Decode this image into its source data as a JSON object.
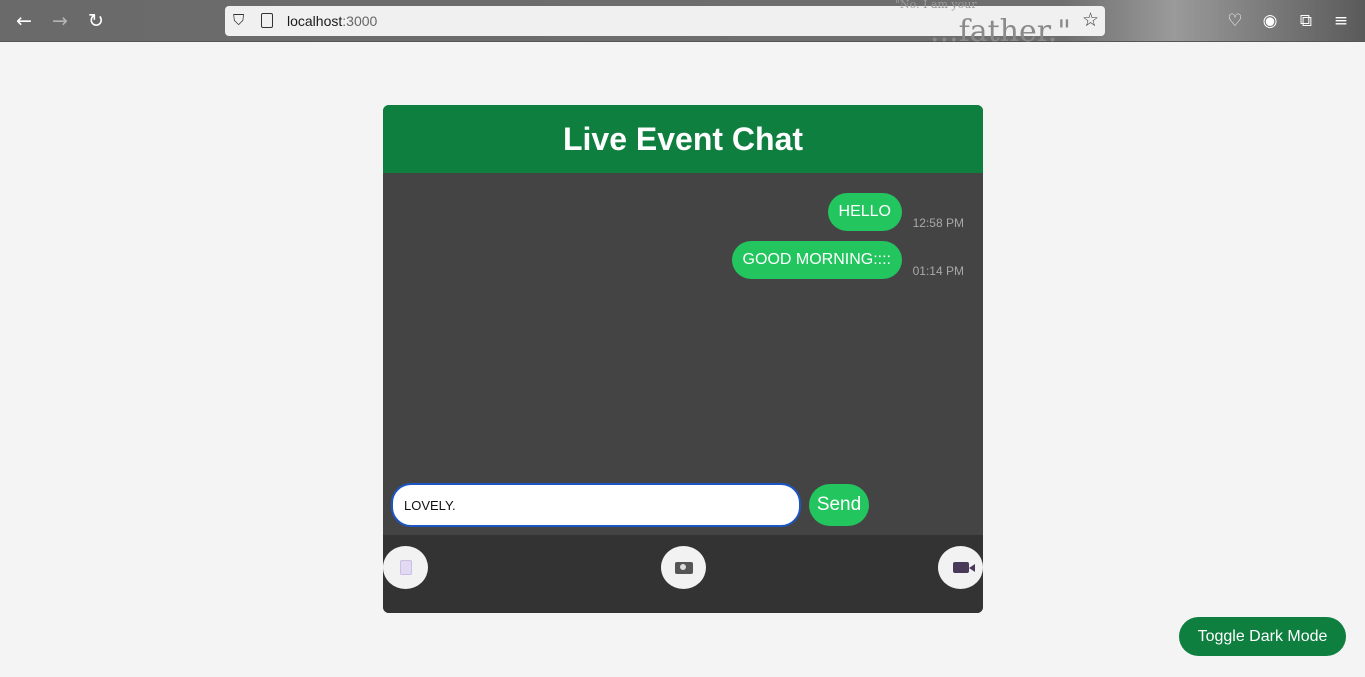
{
  "browser": {
    "url_host": "localhost",
    "url_port": ":3000",
    "theme_text_small": "\"No.  I am your",
    "theme_text_large": "...father.\""
  },
  "chat": {
    "title": "Live Event Chat",
    "messages": [
      {
        "text": "HELLO",
        "time": "12:58 PM"
      },
      {
        "text": "GOOD MORNING::::",
        "time": "01:14 PM"
      }
    ],
    "input": {
      "value": "LOVELY.",
      "placeholder": ""
    },
    "send_label": "Send",
    "actions": [
      {
        "icon": "document-icon"
      },
      {
        "icon": "camera-icon"
      },
      {
        "icon": "video-camera-icon"
      }
    ]
  },
  "toggle_label": "Toggle Dark Mode",
  "colors": {
    "header_green": "#0e7f3f",
    "bubble_green": "#22c55e",
    "chat_bg": "#444444",
    "actions_bg": "#333333"
  }
}
